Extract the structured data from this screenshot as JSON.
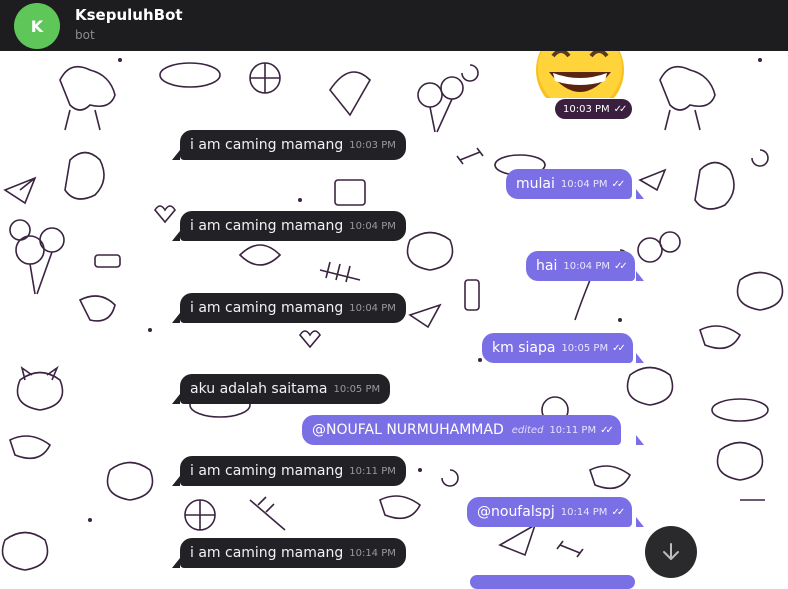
{
  "chat": {
    "avatar_letter": "K",
    "title": "KsepuluhBot",
    "subtitle": "bot"
  },
  "sticker": {
    "time": "10:03 PM"
  },
  "messages": [
    {
      "dir": "in",
      "text": "i am caming mamang",
      "time": "10:03 PM"
    },
    {
      "dir": "out",
      "text": "mulai",
      "time": "10:04 PM"
    },
    {
      "dir": "in",
      "text": "i am caming mamang",
      "time": "10:04 PM"
    },
    {
      "dir": "out",
      "text": "hai",
      "time": "10:04 PM"
    },
    {
      "dir": "in",
      "text": "i am caming mamang",
      "time": "10:04 PM"
    },
    {
      "dir": "out",
      "text": "km siapa",
      "time": "10:05 PM"
    },
    {
      "dir": "in",
      "text": "aku adalah saitama",
      "time": "10:05 PM"
    },
    {
      "dir": "out",
      "text": "@NOUFAL NURMUHAMMAD",
      "edited": "edited",
      "time": "10:11 PM"
    },
    {
      "dir": "in",
      "text": "i am caming mamang",
      "time": "10:11 PM"
    },
    {
      "dir": "out",
      "text": "@noufalspj",
      "time": "10:14 PM"
    },
    {
      "dir": "in",
      "text": "i am caming mamang",
      "time": "10:14 PM"
    }
  ],
  "colors": {
    "header": "#1d1d1f",
    "incoming": "#222226",
    "outgoing": "#7b6fe6",
    "avatar": "#5fc75a"
  },
  "icons": {
    "read_ticks": "double-check-icon",
    "scroll_down": "arrow-down-icon",
    "sticker": "grinning-face-emoji"
  }
}
